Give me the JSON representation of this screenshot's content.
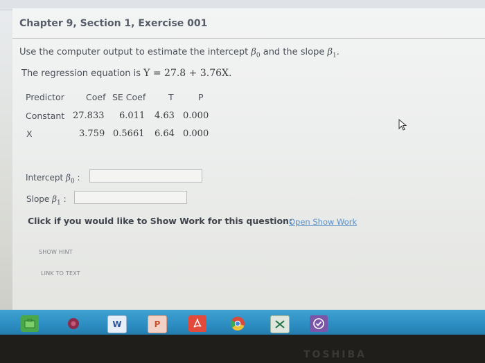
{
  "header": {
    "title": "Chapter 9, Section 1, Exercise 001"
  },
  "question": {
    "text_before_b0": "Use the computer output to estimate the intercept ",
    "text_between": " and the slope ",
    "text_after": ".",
    "beta_symbol": "β",
    "sub0": "0",
    "sub1": "1"
  },
  "regression": {
    "prefix": "The regression equation is ",
    "equation": "Y = 27.8 + 3.76X."
  },
  "table": {
    "headers": [
      "Predictor",
      "Coef",
      "SE Coef",
      "T",
      "P"
    ],
    "rows": [
      {
        "label": "Constant",
        "coef": "27.833",
        "se": "6.011",
        "t": "4.63",
        "p": "0.000"
      },
      {
        "label": "X",
        "coef": "3.759",
        "se": "0.5661",
        "t": "6.64",
        "p": "0.000"
      }
    ]
  },
  "answers": {
    "intercept_label": "Intercept ",
    "slope_label": "Slope ",
    "colon": ":",
    "intercept_value": "",
    "slope_value": ""
  },
  "work": {
    "prompt": "Click if you would like to Show Work for this question:",
    "link": "Open Show Work"
  },
  "buttons": {
    "hint": "SHOW HINT",
    "link_text": "LINK TO TEXT"
  },
  "taskbar": {
    "icons": [
      "store-icon",
      "app-icon",
      "word-icon",
      "powerpoint-icon",
      "acrobat-icon",
      "chrome-icon",
      "excel-icon",
      "media-icon"
    ],
    "word": "W",
    "powerpoint": "P"
  },
  "brand": "TOSHIBA",
  "colors": {
    "taskbar": "#2e8fc4",
    "link": "#5b8fc6",
    "title": "#555d68"
  }
}
